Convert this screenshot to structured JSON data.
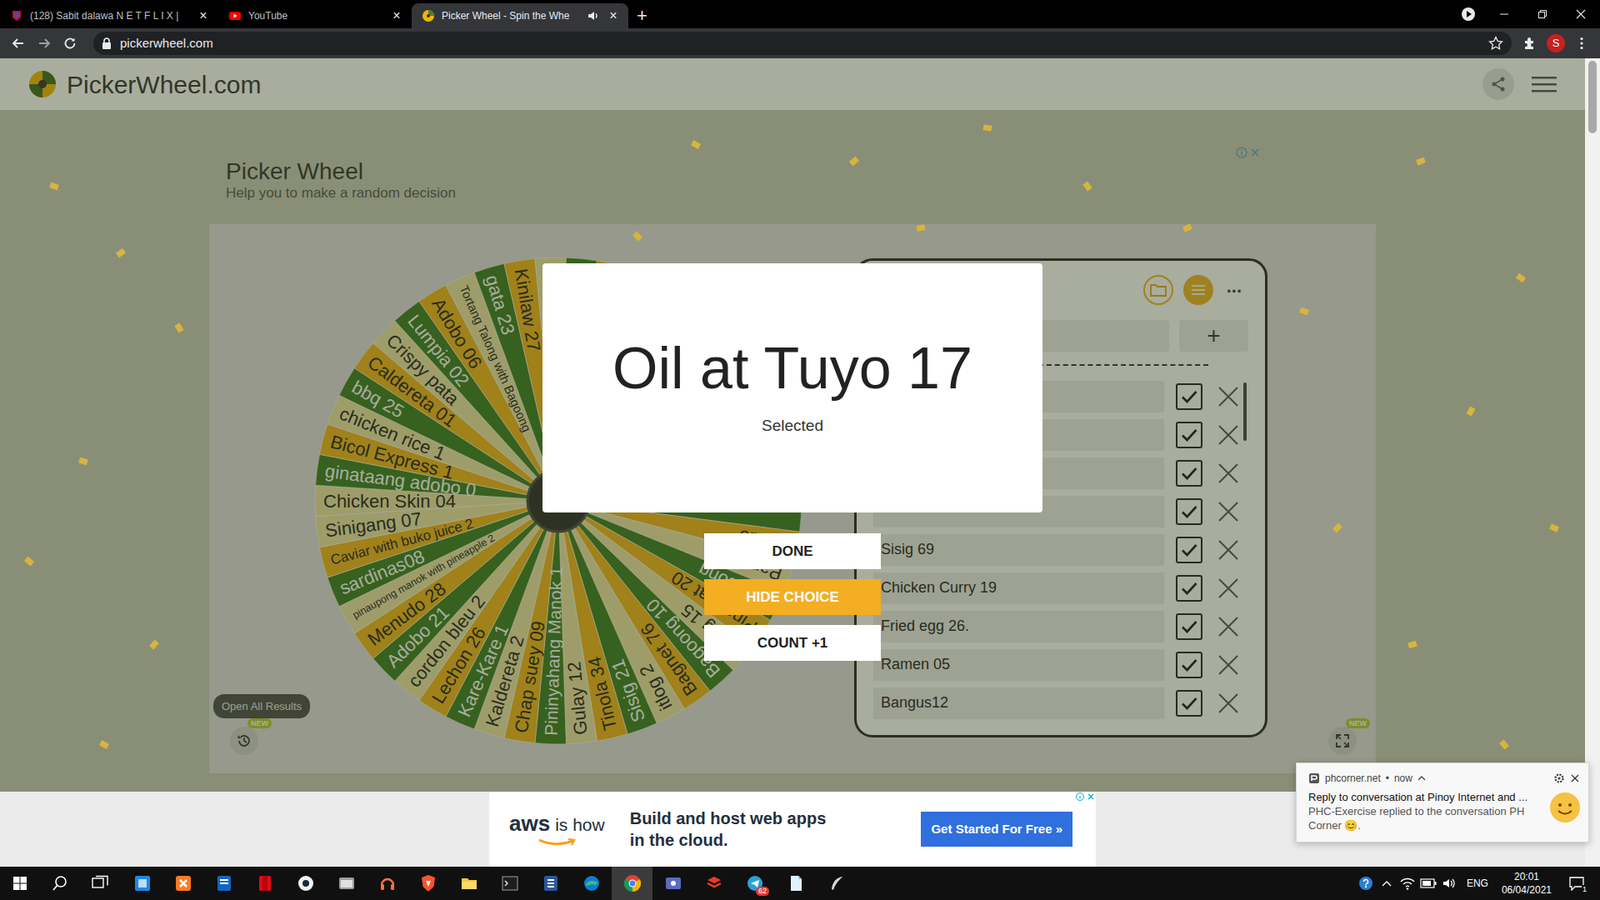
{
  "browser": {
    "tabs": [
      {
        "label": "(128) Sabit dalawa N E T F L I X |",
        "close": "×",
        "selected": false,
        "audio": false
      },
      {
        "label": "YouTube",
        "close": "×",
        "selected": false,
        "audio": false
      },
      {
        "label": "Picker Wheel - Spin the Whe",
        "close": "×",
        "selected": true,
        "audio": true
      }
    ],
    "new_tab": "+",
    "address": "pickerwheel.com",
    "profile": "S"
  },
  "site": {
    "logo": "PickerWheel.com",
    "title": "Picker Wheel",
    "subtitle": "Help you to make a random decision"
  },
  "wheel": {
    "segments": [
      {
        "label": "Chicken Skin 04"
      },
      {
        "label": "ginataang adobo 0"
      },
      {
        "label": "Bicol Express 1"
      },
      {
        "label": "chicken rice 1"
      },
      {
        "label": "bbq 25"
      },
      {
        "label": "Caldereta 01"
      },
      {
        "label": "Crispy pata"
      },
      {
        "label": "Lumpia 02"
      },
      {
        "label": "Adobo 06"
      },
      {
        "label": "Tortang Talong with Bagoong"
      },
      {
        "label": "gata 23"
      },
      {
        "label": "Kinilaw 27"
      },
      {
        "label": ""
      },
      {
        "label": ""
      },
      {
        "label": ""
      },
      {
        "label": ""
      },
      {
        "label": ""
      },
      {
        "label": ""
      },
      {
        "label": ""
      },
      {
        "label": ""
      },
      {
        "label": ""
      },
      {
        "label": ""
      },
      {
        "label": ""
      },
      {
        "label": ""
      },
      {
        "label": ""
      },
      {
        "label": ""
      },
      {
        "label": "Bulalo"
      },
      {
        "label": "Pancit 20"
      },
      {
        "label": "Bombong"
      },
      {
        "label": "Pinangat 20"
      },
      {
        "label": "Laing 15"
      },
      {
        "label": "Bagoong 10"
      },
      {
        "label": "Bagnet 76"
      },
      {
        "label": "itlog 2"
      },
      {
        "label": "Sisig 21"
      },
      {
        "label": "Tinola 34"
      },
      {
        "label": "Gulay 12"
      },
      {
        "label": "Pininyahang Manok 1"
      },
      {
        "label": "Chap suey 09"
      },
      {
        "label": "Kaldereta 2"
      },
      {
        "label": "Kare-Kare 1"
      },
      {
        "label": "Lechon 26"
      },
      {
        "label": "cordon bleu 2"
      },
      {
        "label": "Adobo 21"
      },
      {
        "label": "Menudo 28"
      },
      {
        "label": "pinaupong manok with pineapple 2"
      },
      {
        "label": "sardinas08"
      },
      {
        "label": "Caviar with buko juice 2"
      },
      {
        "label": "Sinigang 07"
      }
    ]
  },
  "results_button": {
    "label": "Open All Results"
  },
  "history": {
    "badge": "NEW"
  },
  "fullscreen": {
    "badge": "NEW"
  },
  "panel": {
    "more": "...",
    "add": "+",
    "entries": [
      {
        "text": "",
        "checked": true
      },
      {
        "text": "",
        "checked": true
      },
      {
        "text": "",
        "checked": true
      },
      {
        "text": "",
        "checked": true
      },
      {
        "text": "Sisig 69",
        "checked": true
      },
      {
        "text": "Chicken Curry 19",
        "checked": true
      },
      {
        "text": "Fried egg 26.",
        "checked": true
      },
      {
        "text": "Ramen 05",
        "checked": true
      },
      {
        "text": "Bangus12",
        "checked": true
      }
    ]
  },
  "result": {
    "choice": "Oil at Tuyo 17",
    "caption": "Selected",
    "buttons": [
      {
        "label": "DONE",
        "highlighted": false
      },
      {
        "label": "HIDE CHOICE",
        "highlighted": true
      },
      {
        "label": "COUNT +1",
        "highlighted": false
      }
    ]
  },
  "ad": {
    "brand": "aws",
    "tagline": "is how",
    "headline": [
      "Build and host web apps",
      "in the cloud."
    ],
    "cta": "Get Started For Free »"
  },
  "notification": {
    "source": "phcorner.net",
    "separator": "•",
    "time": "now",
    "title": "Reply to conversation at Pinoy Internet and ...",
    "body": "PHC-Exercise replied to the conversation PH Corner 😊."
  },
  "taskbar": {
    "apps": [
      {
        "selected": false
      },
      {
        "selected": false
      },
      {
        "selected": false
      },
      {
        "selected": false
      },
      {
        "selected": false
      },
      {
        "selected": false
      },
      {
        "selected": false
      },
      {
        "selected": false
      },
      {
        "selected": false
      },
      {
        "selected": false
      },
      {
        "selected": false
      },
      {
        "selected": false
      },
      {
        "selected": true
      },
      {
        "selected": false
      },
      {
        "selected": false
      },
      {
        "selected": false,
        "badge": "62"
      },
      {
        "selected": false
      },
      {
        "selected": false
      }
    ],
    "language": "ENG",
    "time": "20:01",
    "date": "06/04/2021",
    "notifications": "1"
  }
}
